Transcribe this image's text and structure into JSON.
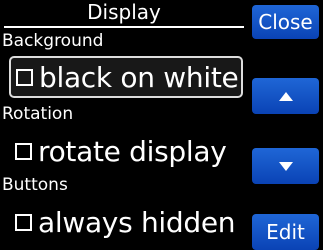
{
  "title": "Display",
  "sections": [
    {
      "label": "Background",
      "option": {
        "label": "black on white",
        "checked": false,
        "selected": true
      }
    },
    {
      "label": "Rotation",
      "option": {
        "label": "rotate display",
        "checked": false,
        "selected": false
      }
    },
    {
      "label": "Buttons",
      "option": {
        "label": "always hidden",
        "checked": false,
        "selected": false
      }
    }
  ],
  "buttons": {
    "close": "Close",
    "up_icon": "arrow-up-icon",
    "down_icon": "arrow-down-icon",
    "edit": "Edit"
  },
  "colors": {
    "background": "#000000",
    "button": "#1254c8",
    "text": "#ffffff"
  }
}
